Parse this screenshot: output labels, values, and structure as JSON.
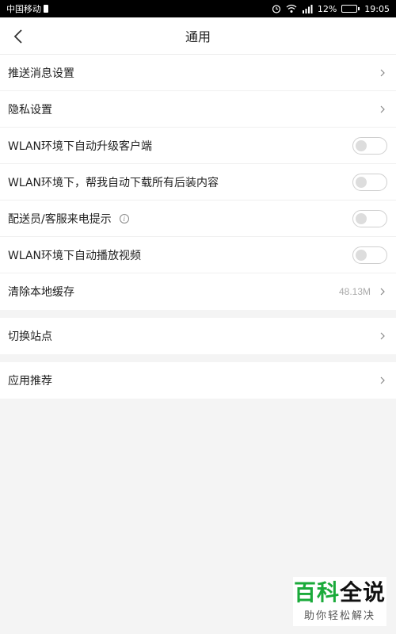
{
  "status_bar": {
    "carrier": "中国移动",
    "signal_label": "4G",
    "battery_percent": "12%",
    "battery_level": 0.12,
    "time": "19:05"
  },
  "header": {
    "title": "通用"
  },
  "settings": {
    "push": {
      "label": "推送消息设置"
    },
    "privacy": {
      "label": "隐私设置"
    },
    "wlan_upgrade": {
      "label": "WLAN环境下自动升级客户端",
      "enabled": false
    },
    "wlan_download": {
      "label": "WLAN环境下，帮我自动下载所有后装内容",
      "enabled": false
    },
    "courier_call": {
      "label": "配送员/客服来电提示",
      "enabled": false
    },
    "wlan_video": {
      "label": "WLAN环境下自动播放视频",
      "enabled": false
    },
    "clear_cache": {
      "label": "清除本地缓存",
      "value": "48.13M"
    },
    "switch_site": {
      "label": "切换站点"
    },
    "app_recommend": {
      "label": "应用推荐"
    }
  },
  "watermark": {
    "title_a": "百科",
    "title_b": "全说",
    "subtitle": "助你轻松解决"
  }
}
